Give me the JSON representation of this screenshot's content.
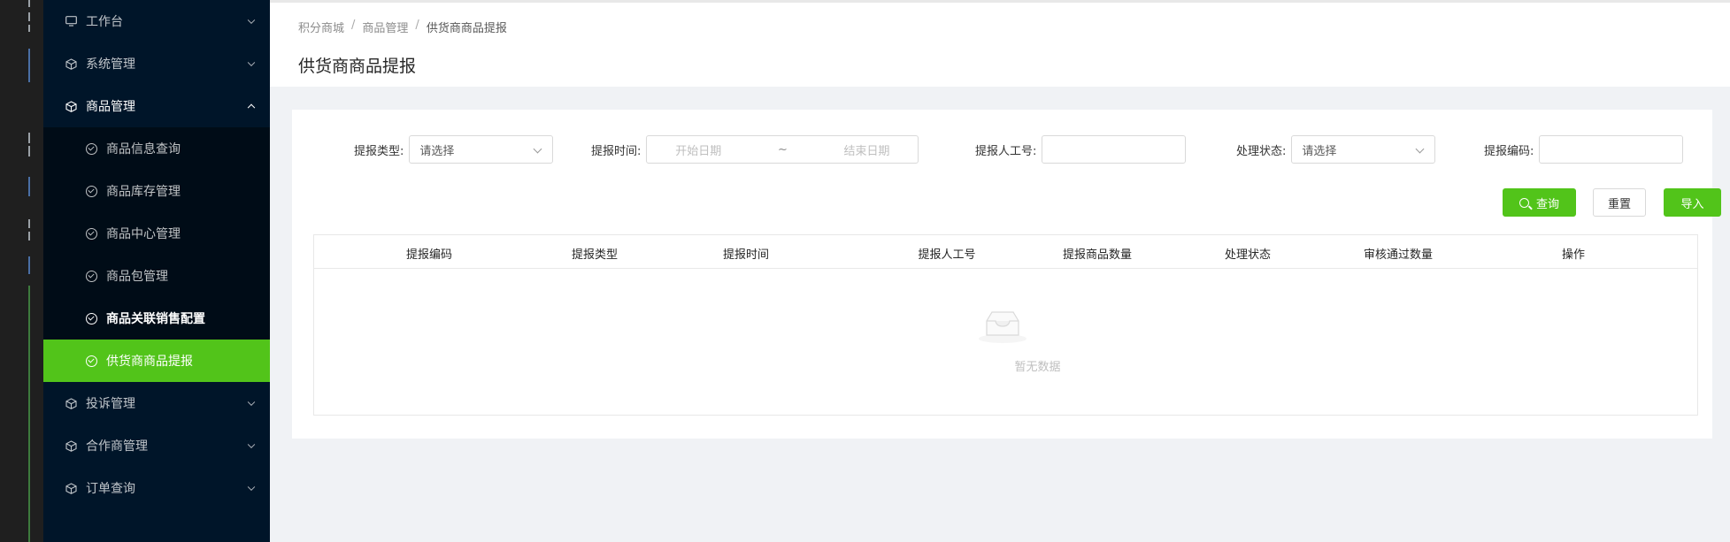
{
  "sidebar": {
    "items": [
      {
        "label": "工作台",
        "icon": "monitor-icon"
      },
      {
        "label": "系统管理",
        "icon": "cube-icon"
      },
      {
        "label": "商品管理",
        "icon": "cube-icon"
      },
      {
        "label": "投诉管理",
        "icon": "cube-icon"
      },
      {
        "label": "合作商管理",
        "icon": "cube-icon"
      },
      {
        "label": "订单查询",
        "icon": "cube-icon"
      }
    ],
    "submenu": [
      {
        "label": "商品信息查询"
      },
      {
        "label": "商品库存管理"
      },
      {
        "label": "商品中心管理"
      },
      {
        "label": "商品包管理"
      },
      {
        "label": "商品关联销售配置"
      },
      {
        "label": "供货商商品提报"
      }
    ],
    "active_color": "#52c41a",
    "background": "#001529"
  },
  "breadcrumb": [
    "积分商城",
    "商品管理",
    "供货商商品提报"
  ],
  "page_title": "供货商商品提报",
  "filters": {
    "type_label": "提报类型:",
    "type_value": "请选择",
    "time_label": "提报时间:",
    "start_placeholder": "开始日期",
    "range_sep": "~",
    "end_placeholder": "结束日期",
    "staff_label": "提报人工号:",
    "staff_value": "",
    "status_label": "处理状态:",
    "status_value": "请选择",
    "code_label": "提报编码:",
    "code_value": ""
  },
  "buttons": {
    "query": "查询",
    "reset": "重置",
    "import": "导入"
  },
  "table": {
    "columns": [
      "提报编码",
      "提报类型",
      "提报时间",
      "提报人工号",
      "提报商品数量",
      "处理状态",
      "审核通过数量",
      "操作"
    ],
    "empty_text": "暂无数据"
  }
}
